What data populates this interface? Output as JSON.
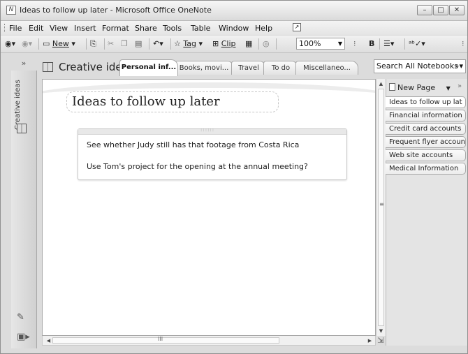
{
  "window": {
    "title": "Ideas to follow up later - Microsoft Office OneNote",
    "app_icon_glyph": "N",
    "buttons": [
      "–",
      "□",
      "✕"
    ]
  },
  "menubar": {
    "items": [
      "File",
      "Edit",
      "View",
      "Insert",
      "Format",
      "Share",
      "Tools",
      "Table",
      "Window",
      "Help"
    ]
  },
  "toolbar": {
    "new_label": "New",
    "tag_label": "Tag",
    "clip_label": "Clip",
    "zoom": "100%"
  },
  "notebook": {
    "title": "Creative ide...",
    "nav_chevron": "»",
    "sections": [
      {
        "label": "Personal inf...",
        "active": true
      },
      {
        "label": "Books, movi...",
        "active": false
      },
      {
        "label": "Travel",
        "active": false
      },
      {
        "label": "To do",
        "active": false
      },
      {
        "label": "Miscellaneo...",
        "active": false
      }
    ],
    "search_placeholder": "Search All Notebooks"
  },
  "left_nav": {
    "label": "Creative ideas"
  },
  "page": {
    "title": "Ideas to follow up later",
    "notes": [
      "See whether Judy still has that footage from Costa Rica",
      "Use Tom's project for the opening at the annual meeting?"
    ]
  },
  "pages_panel": {
    "new_page_label": "New Page",
    "pages": [
      {
        "label": "Ideas to follow up lat",
        "active": true
      },
      {
        "label": "Financial information",
        "active": false
      },
      {
        "label": "Credit card accounts",
        "active": false
      },
      {
        "label": "Frequent flyer accoun",
        "active": false
      },
      {
        "label": "Web site accounts",
        "active": false
      },
      {
        "label": "Medical Information",
        "active": false
      }
    ]
  },
  "icons": {
    "back": "back-icon",
    "forward": "forward-icon",
    "new_page": "new-page-icon",
    "save": "save-icon",
    "cut": "cut-icon",
    "copy": "copy-icon",
    "paste": "paste-icon",
    "undo": "undo-icon",
    "tag": "star-icon",
    "clip": "clip-icon",
    "table": "table-icon",
    "bold": "bold-icon",
    "bullets": "bullets-icon",
    "spelling": "spelling-icon"
  }
}
